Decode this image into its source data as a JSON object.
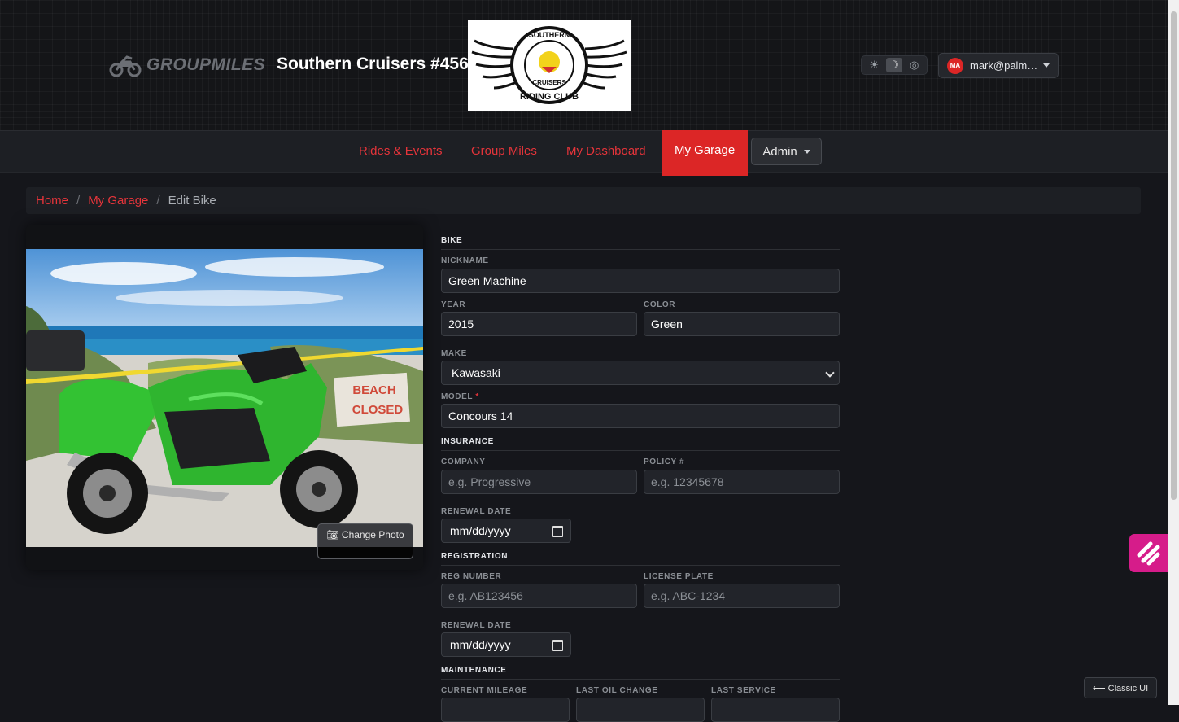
{
  "header": {
    "brand": "GROUPMILES",
    "club_title": "Southern Cruisers #456",
    "club_logo_text": [
      "SOUTHERN",
      "CRUISERS",
      "RIDING CLUB"
    ],
    "theme_options": [
      "sun-icon",
      "moon-icon",
      "auto-icon"
    ],
    "user": {
      "initials": "MA",
      "name": "mark@palm…"
    }
  },
  "nav": {
    "items": [
      "Rides & Events",
      "Group Miles",
      "My Dashboard",
      "My Garage"
    ],
    "active": "My Garage",
    "admin_label": "Admin"
  },
  "breadcrumb": {
    "home": "Home",
    "garage": "My Garage",
    "current": "Edit Bike"
  },
  "photo": {
    "change_label": "Change Photo",
    "sign_text": [
      "BEACH",
      "CLOSED"
    ]
  },
  "form": {
    "bike": {
      "heading": "BIKE",
      "nickname_label": "NICKNAME",
      "nickname": "Green Machine",
      "year_label": "YEAR",
      "year": "2015",
      "color_label": "COLOR",
      "color": "Green",
      "make_label": "MAKE",
      "make": "Kawasaki",
      "model_label": "MODEL",
      "model_required": "*",
      "model": "Concours 14"
    },
    "insurance": {
      "heading": "INSURANCE",
      "company_label": "COMPANY",
      "company_placeholder": "e.g. Progressive",
      "policy_label": "POLICY #",
      "policy_placeholder": "e.g. 12345678",
      "renewal_label": "RENEWAL DATE",
      "renewal_placeholder": "mm/dd/yyyy"
    },
    "registration": {
      "heading": "REGISTRATION",
      "reg_label": "REG NUMBER",
      "reg_placeholder": "e.g. AB123456",
      "plate_label": "LICENSE PLATE",
      "plate_placeholder": "e.g. ABC-1234",
      "renewal_label": "RENEWAL DATE",
      "renewal_placeholder": "mm/dd/yyyy"
    },
    "maintenance": {
      "heading": "MAINTENANCE",
      "mileage_label": "CURRENT MILEAGE",
      "oil_label": "LAST OIL CHANGE",
      "service_label": "LAST SERVICE"
    }
  },
  "classic_ui": "⟵ Classic UI",
  "colors": {
    "accent": "#dc2626",
    "link": "#e5343a",
    "bg": "#15161b",
    "widget": "#d61c8a"
  }
}
